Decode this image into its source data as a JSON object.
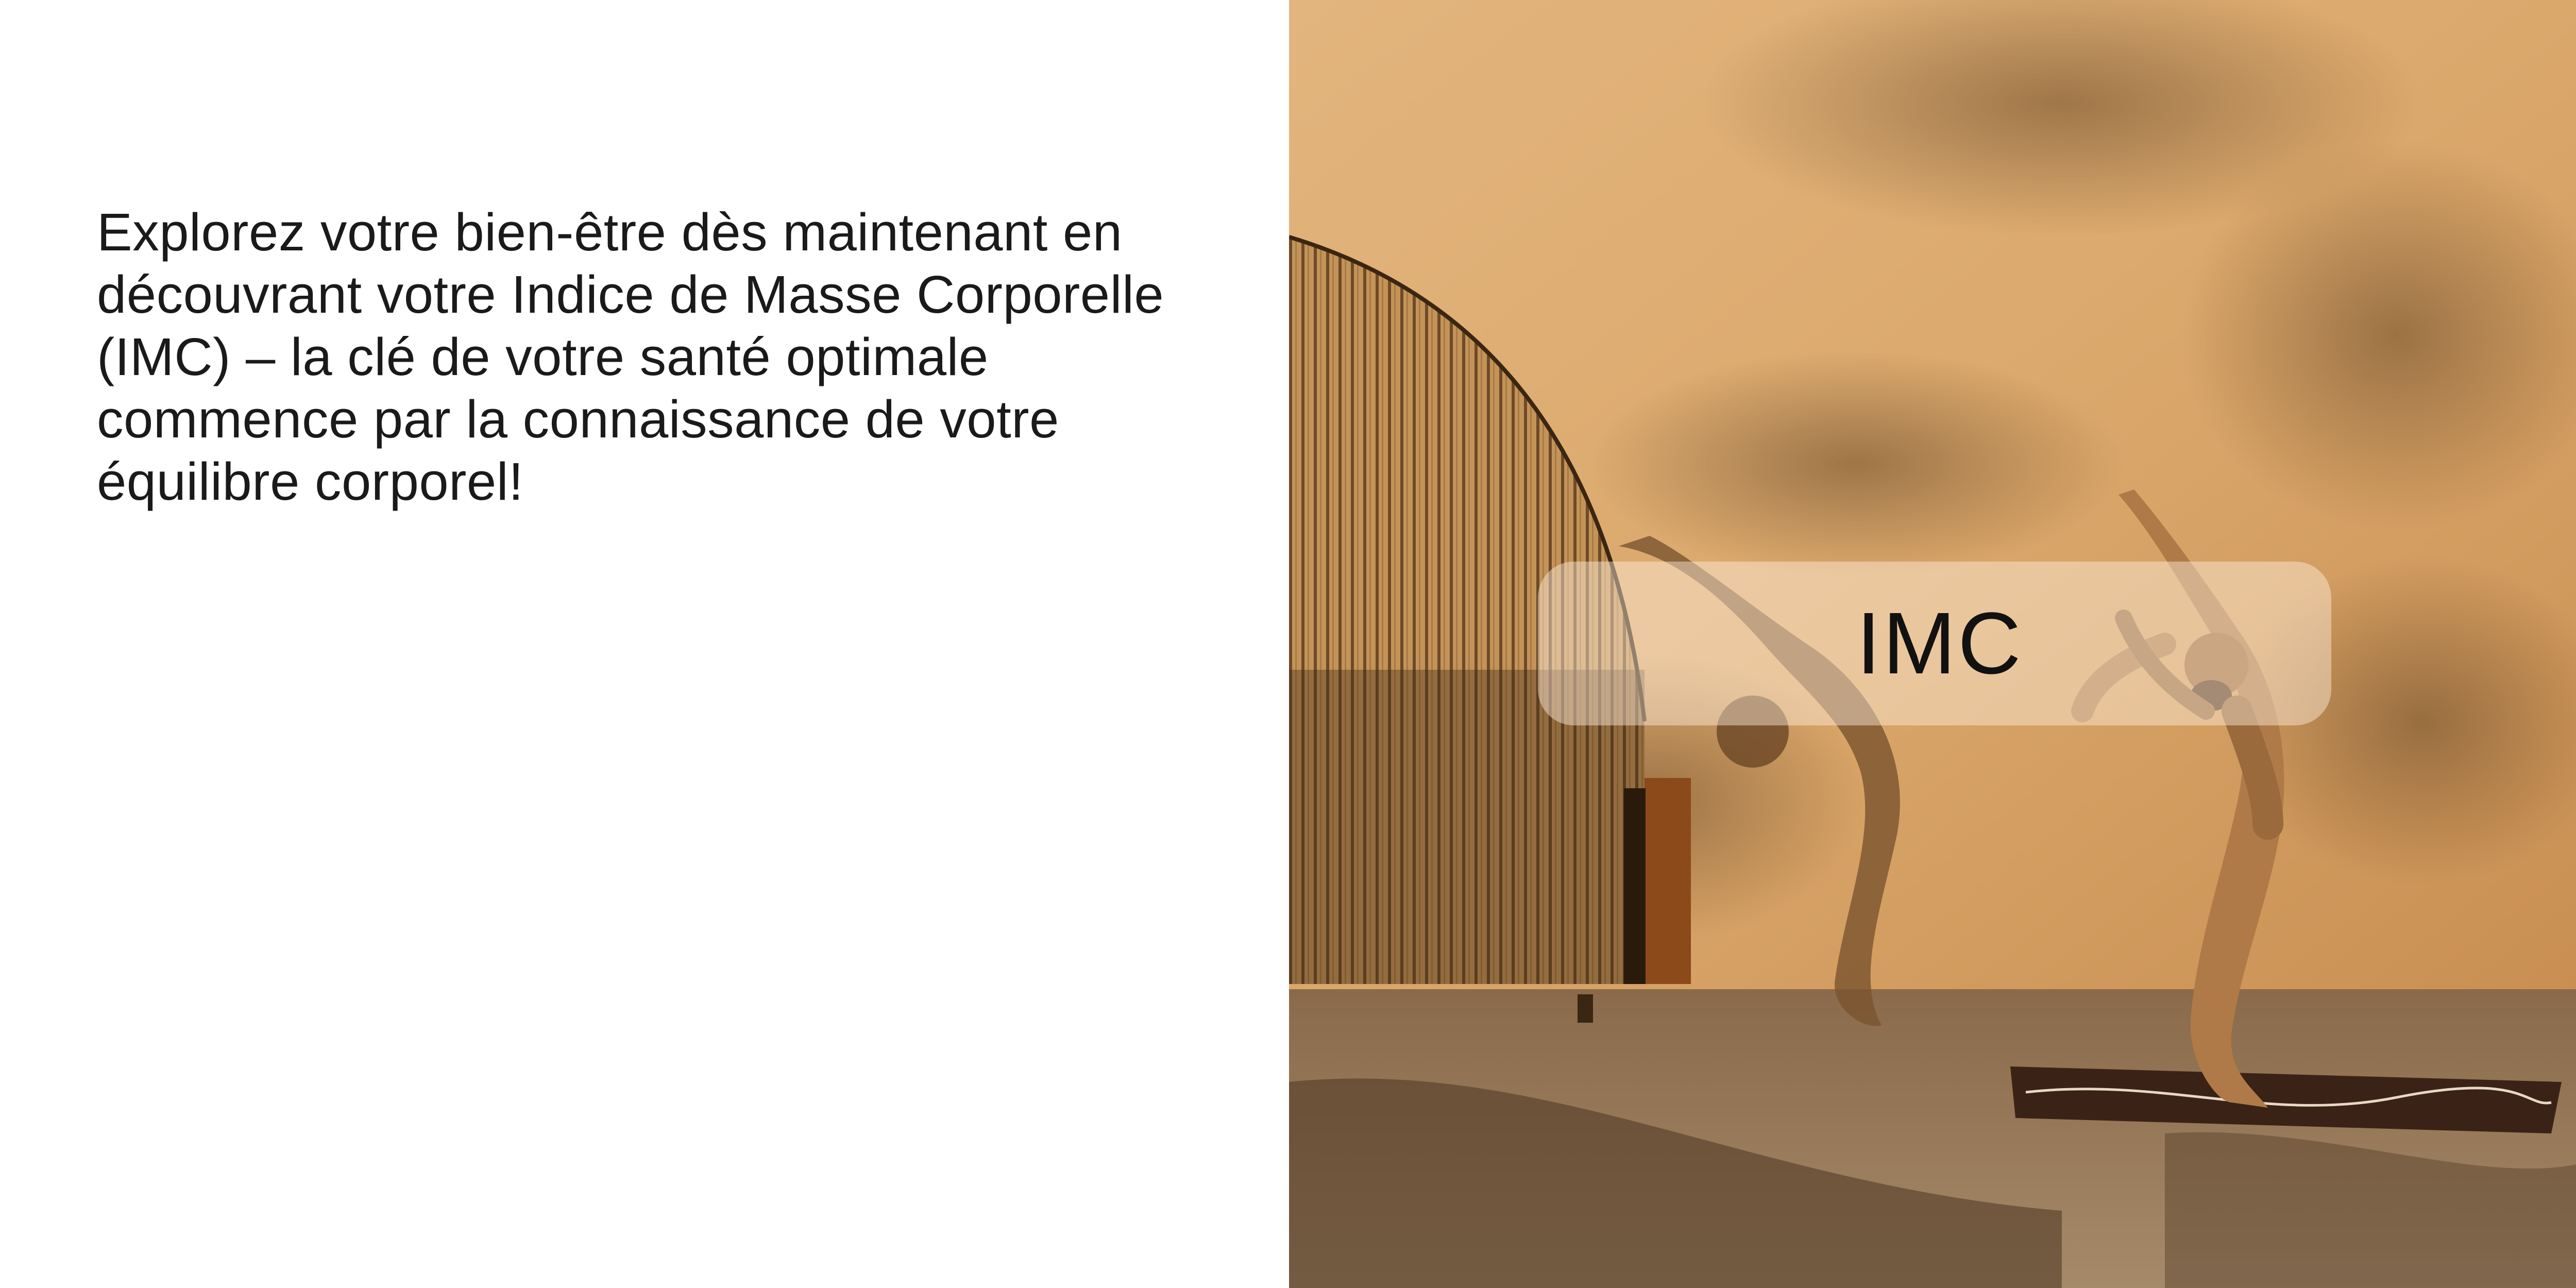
{
  "slide": {
    "intro_text": "Explorez votre bien-être dès maintenant en découvrant votre Indice de Masse Corporelle (IMC) – la clé de votre santé optimale commence par la connaissance de votre équilibre corporel!",
    "title": "IMC"
  },
  "photo": {
    "subject": "yoga-backbend-photo"
  },
  "colors": {
    "background": "#ffffff",
    "text": "#1a1a1a",
    "wall": "#d9a86a",
    "pill": "#fff0de"
  }
}
